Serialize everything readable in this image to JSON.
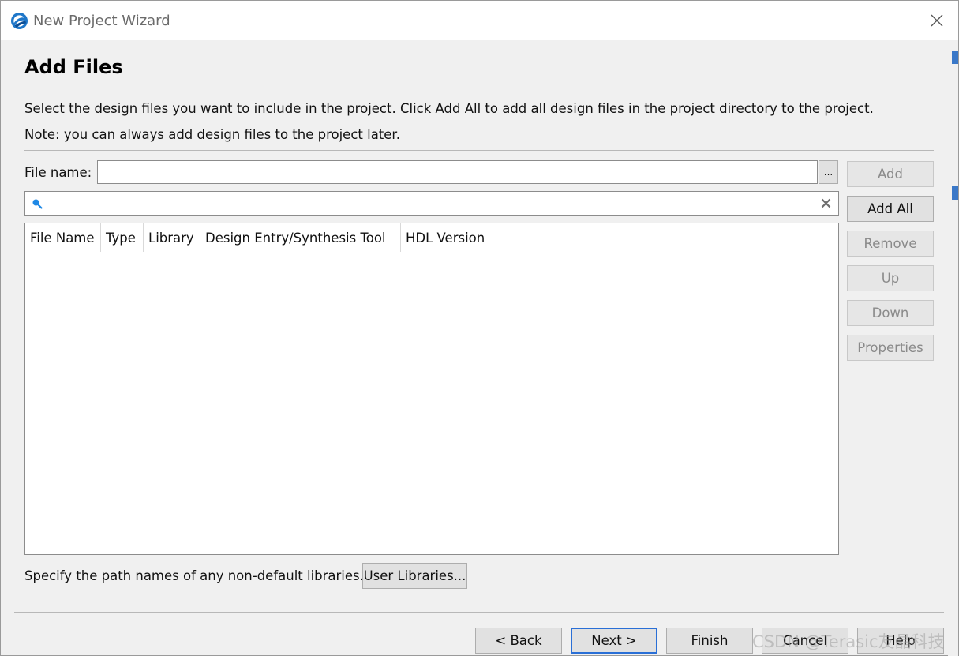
{
  "window": {
    "title": "New Project Wizard",
    "icon": "quartus-globe-icon",
    "close": "close-icon"
  },
  "page": {
    "heading": "Add Files",
    "description_line1": "Select the design files you want to include in the project. Click Add All to add all design files in the project directory to the project.",
    "description_line2": "Note: you can always add design files to the project later."
  },
  "file_name": {
    "label": "File name:",
    "value": "",
    "browse_label": "..."
  },
  "search": {
    "value": "",
    "icon": "search-icon",
    "clear_icon": "clear-icon"
  },
  "table": {
    "columns": [
      "File Name",
      "Type",
      "Library",
      "Design Entry/Synthesis Tool",
      "HDL Version"
    ],
    "rows": []
  },
  "side_buttons": {
    "add": "Add",
    "add_all": "Add All",
    "remove": "Remove",
    "up": "Up",
    "down": "Down",
    "properties": "Properties"
  },
  "libraries": {
    "text": "Specify the path names of any non-default libraries.",
    "button": "User Libraries..."
  },
  "footer": {
    "back": "< Back",
    "next": "Next >",
    "finish": "Finish",
    "cancel": "Cancel",
    "help": "Help"
  },
  "watermark": "CSDN @Terasic友晶科技",
  "colors": {
    "accent": "#2a6fd6",
    "title_text": "#6b6b6b",
    "disabled_text": "#8a8a8a"
  }
}
